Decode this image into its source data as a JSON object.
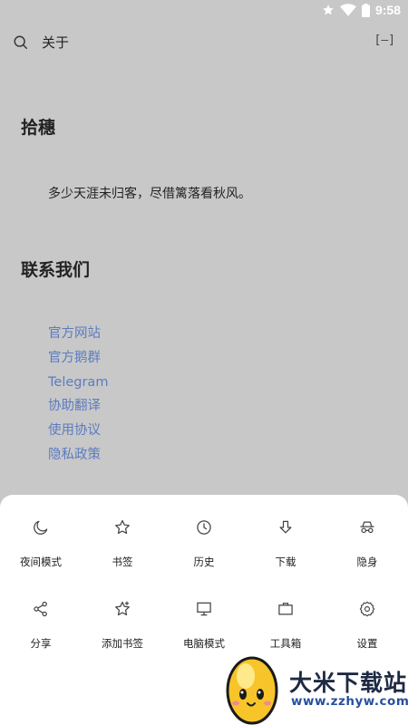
{
  "status_bar": {
    "time": "9:58"
  },
  "toolbar": {
    "title": "关于",
    "tabs_button": "[–]"
  },
  "about": {
    "app_name": "拾穗",
    "tagline": "多少天涯未归客，尽借篱落看秋风。"
  },
  "contact": {
    "heading": "联系我们",
    "links": [
      "官方网站",
      "官方鹅群",
      "Telegram",
      "协助翻译",
      "使用协议",
      "隐私政策"
    ]
  },
  "menu": {
    "items": [
      {
        "label": "夜间模式",
        "icon": "moon-icon"
      },
      {
        "label": "书签",
        "icon": "star-icon"
      },
      {
        "label": "历史",
        "icon": "clock-icon"
      },
      {
        "label": "下载",
        "icon": "download-icon"
      },
      {
        "label": "隐身",
        "icon": "incognito-icon"
      },
      {
        "label": "分享",
        "icon": "share-icon"
      },
      {
        "label": "添加书签",
        "icon": "star-plus-icon"
      },
      {
        "label": "电脑模式",
        "icon": "monitor-icon"
      },
      {
        "label": "工具箱",
        "icon": "toolbox-icon"
      },
      {
        "label": "设置",
        "icon": "gear-icon"
      }
    ]
  },
  "watermark": {
    "title": "大米下载站",
    "url": "www.zzhyw.com"
  }
}
